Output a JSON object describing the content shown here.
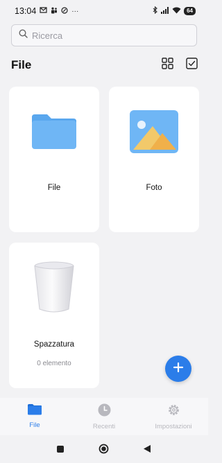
{
  "status_bar": {
    "time": "13:04",
    "left_glyphs": [
      "mail-icon",
      "teams-icon",
      "app-icon",
      "···"
    ],
    "battery": "64"
  },
  "search": {
    "placeholder": "Ricerca"
  },
  "header": {
    "title": "File"
  },
  "cards": [
    {
      "label": "File",
      "icon": "folder-icon"
    },
    {
      "label": "Foto",
      "icon": "photo-icon"
    },
    {
      "label": "Spazzatura",
      "sub": "0 elemento",
      "icon": "trash-icon"
    }
  ],
  "bottom_nav": [
    {
      "label": "File",
      "icon": "folder-icon",
      "active": true
    },
    {
      "label": "Recenti",
      "icon": "clock-icon",
      "active": false
    },
    {
      "label": "Impostazioni",
      "icon": "gear-icon",
      "active": false
    }
  ],
  "colors": {
    "accent": "#2b7de9",
    "folder": "#6fb6f5",
    "inactive": "#b8b8be"
  }
}
